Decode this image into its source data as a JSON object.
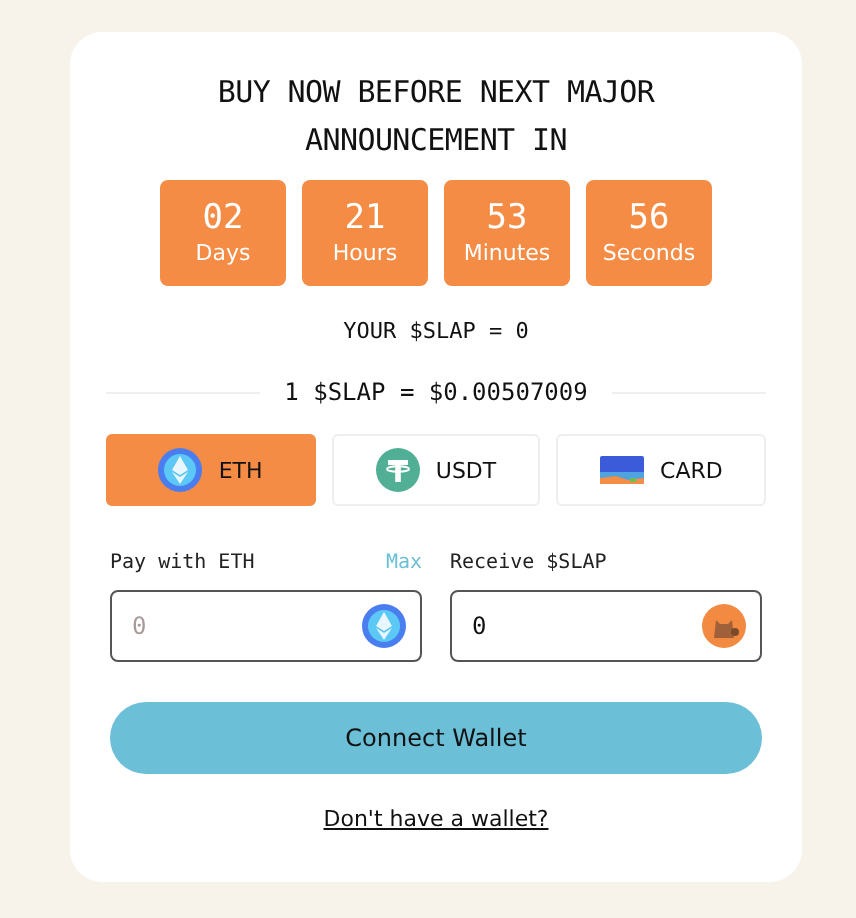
{
  "title": "BUY NOW BEFORE NEXT MAJOR ANNOUNCEMENT IN",
  "countdown": [
    {
      "value": "02",
      "label": "Days"
    },
    {
      "value": "21",
      "label": "Hours"
    },
    {
      "value": "53",
      "label": "Minutes"
    },
    {
      "value": "56",
      "label": "Seconds"
    }
  ],
  "balance": "YOUR $SLAP = 0",
  "rate": "1 $SLAP = $0.00507009",
  "tabs": [
    {
      "label": "ETH",
      "kind": "eth",
      "selected": true
    },
    {
      "label": "USDT",
      "kind": "usdt",
      "selected": false
    },
    {
      "label": "CARD",
      "kind": "card",
      "selected": false
    }
  ],
  "pay": {
    "label": "Pay with ETH",
    "max": "Max",
    "placeholder": "0"
  },
  "receive": {
    "label": "Receive $SLAP",
    "value": "0"
  },
  "button": "Connect Wallet",
  "link": "Don't have a wallet?"
}
